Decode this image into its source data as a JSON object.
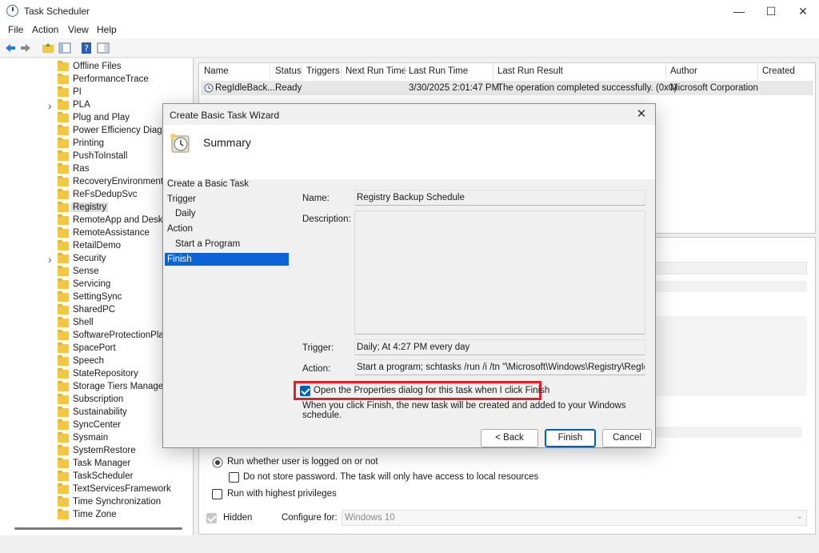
{
  "window": {
    "title": "Task Scheduler"
  },
  "menu": [
    "File",
    "Action",
    "View",
    "Help"
  ],
  "tree": {
    "items": [
      {
        "label": "Offline Files"
      },
      {
        "label": "PerformanceTrace"
      },
      {
        "label": "PI"
      },
      {
        "label": "PLA",
        "expandable": true
      },
      {
        "label": "Plug and Play"
      },
      {
        "label": "Power Efficiency Diagnostics"
      },
      {
        "label": "Printing"
      },
      {
        "label": "PushToInstall"
      },
      {
        "label": "Ras"
      },
      {
        "label": "RecoveryEnvironment"
      },
      {
        "label": "ReFsDedupSvc"
      },
      {
        "label": "Registry",
        "selected": true
      },
      {
        "label": "RemoteApp and Desktop Connections Update"
      },
      {
        "label": "RemoteAssistance"
      },
      {
        "label": "RetailDemo"
      },
      {
        "label": "Security",
        "expandable": true
      },
      {
        "label": "Sense"
      },
      {
        "label": "Servicing"
      },
      {
        "label": "SettingSync"
      },
      {
        "label": "SharedPC"
      },
      {
        "label": "Shell"
      },
      {
        "label": "SoftwareProtectionPlatform"
      },
      {
        "label": "SpacePort"
      },
      {
        "label": "Speech"
      },
      {
        "label": "StateRepository"
      },
      {
        "label": "Storage Tiers Management"
      },
      {
        "label": "Subscription"
      },
      {
        "label": "Sustainability"
      },
      {
        "label": "SyncCenter"
      },
      {
        "label": "Sysmain"
      },
      {
        "label": "SystemRestore"
      },
      {
        "label": "Task Manager"
      },
      {
        "label": "TaskScheduler"
      },
      {
        "label": "TextServicesFramework"
      },
      {
        "label": "Time Synchronization"
      },
      {
        "label": "Time Zone"
      }
    ]
  },
  "tasklist": {
    "columns": [
      "Name",
      "Status",
      "Triggers",
      "Next Run Time",
      "Last Run Time",
      "Last Run Result",
      "Author",
      "Created"
    ],
    "row": {
      "name": "RegIdleBack...",
      "status": "Ready",
      "triggers": "",
      "next_run": "",
      "last_run": "3/30/2025 2:01:47 PM",
      "result": "The operation completed successfully. (0x0)",
      "author": "Microsoft Corporation",
      "created": ""
    }
  },
  "general": {
    "run_logged_on": "Run whether user is logged on or not",
    "no_store_password": "Do not store password.  The task will only have access to local resources",
    "highest_privileges": "Run with highest privileges",
    "hidden": "Hidden",
    "configure_for_label": "Configure for:",
    "configure_for_value": "Windows 10"
  },
  "dialog": {
    "title": "Create Basic Task Wizard",
    "heading": "Summary",
    "steps": [
      {
        "label": "Create a Basic Task",
        "indent": false
      },
      {
        "label": "Trigger",
        "indent": false
      },
      {
        "label": "Daily",
        "indent": true
      },
      {
        "label": "Action",
        "indent": false
      },
      {
        "label": "Start a Program",
        "indent": true
      },
      {
        "label": "Finish",
        "indent": false,
        "selected": true
      }
    ],
    "name_label": "Name:",
    "name_value": "Registry Backup Schedule",
    "description_label": "Description:",
    "trigger_label": "Trigger:",
    "trigger_value": "Daily; At 4:27 PM every day",
    "action_label": "Action:",
    "action_value": "Start a program; schtasks /run /i /tn \"\\Microsoft\\Windows\\Registry\\RegIdleBackup\"",
    "open_properties_label": "Open the Properties dialog for this task when I click Finish",
    "open_properties_checked": true,
    "finish_note": "When you click Finish, the new task will be created and added to your Windows schedule.",
    "back_label": "< Back",
    "finish_label": "Finish",
    "cancel_label": "Cancel"
  },
  "colors": {
    "accent": "#005fb8",
    "selection": "#0a64d6",
    "highlight_box": "#e0202a",
    "folder": "#f3c744"
  }
}
